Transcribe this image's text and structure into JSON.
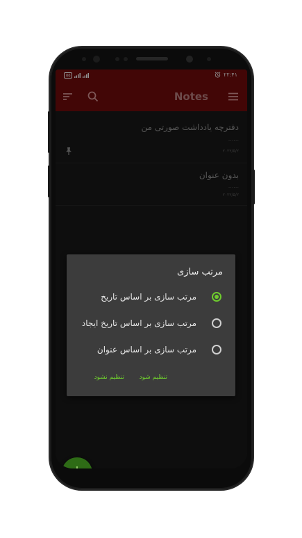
{
  "status": {
    "battery": "۵۵",
    "signal1_icon": "signal-bars",
    "signal2_icon": "signal-bars",
    "alarm_icon": "alarm-clock",
    "time": "۲۲:۴۱"
  },
  "appbar": {
    "title": "Notes",
    "sort_icon": "sort-icon",
    "search_icon": "search-icon",
    "menu_icon": "menu-icon"
  },
  "notes": [
    {
      "title": "دفترچه یادداشت صورتی من",
      "body": "......",
      "date": "۲۰۲۲/۵/۲",
      "pinned": true
    },
    {
      "title": "بدون عنوان",
      "body": "......",
      "date": "۲۰۲۲/۵/۲",
      "pinned": false
    }
  ],
  "dialog": {
    "title": "مرتب سازی",
    "options": [
      {
        "label": "مرتب سازی بر اساس تاریخ",
        "checked": true
      },
      {
        "label": "مرتب سازی بر اساس تاریخ ایجاد",
        "checked": false
      },
      {
        "label": "مرتب سازی بر اساس عنوان",
        "checked": false
      }
    ],
    "confirm_label": "تنظیم شود",
    "cancel_label": "تنظیم نشود"
  },
  "fab": {
    "label": "+"
  },
  "colors": {
    "appbar": "#6b0a0a",
    "accent": "#6ecb2e",
    "fab": "#2e6b16",
    "dialog": "#3c3c3c"
  }
}
